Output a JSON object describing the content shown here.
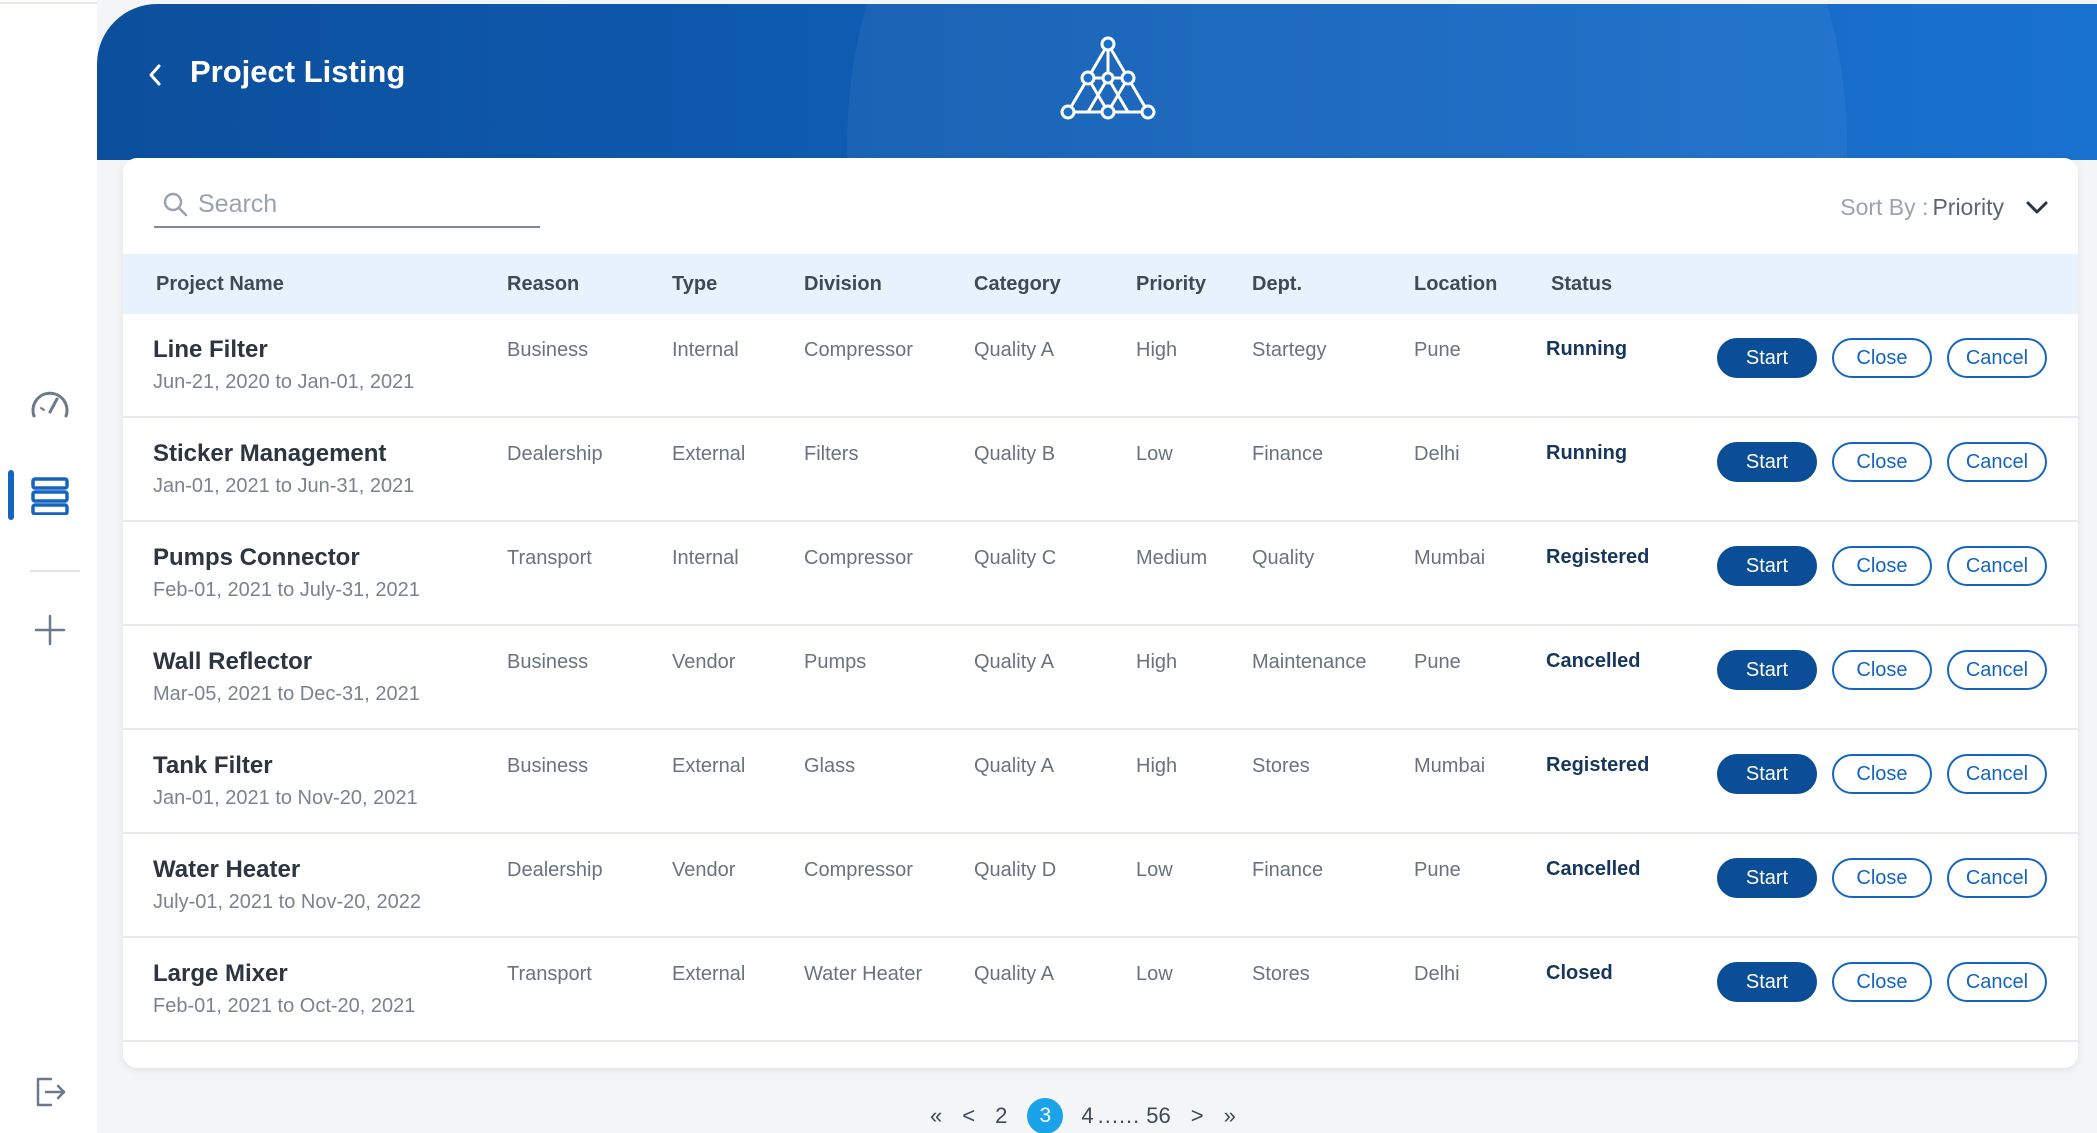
{
  "header": {
    "title": "Project Listing",
    "back_icon": "chevron-left-icon",
    "logo_icon": "network-triangle-logo"
  },
  "sidebar": {
    "items": [
      {
        "icon": "speedometer-icon",
        "active": false
      },
      {
        "icon": "database-list-icon",
        "active": true
      },
      {
        "icon": "plus-icon",
        "active": false
      },
      {
        "icon": "logout-icon",
        "active": false
      }
    ]
  },
  "search": {
    "placeholder": "Search",
    "value": ""
  },
  "sort": {
    "label": "Sort By :",
    "value": "Priority"
  },
  "table": {
    "columns": [
      "Project Name",
      "Reason",
      "Type",
      "Division",
      "Category",
      "Priority",
      "Dept.",
      "Location",
      "Status"
    ],
    "rows": [
      {
        "name": "Line Filter",
        "dates": "Jun-21, 2020 to Jan-01, 2021",
        "reason": "Business",
        "type": "Internal",
        "division": "Compressor",
        "category": "Quality A",
        "priority": "High",
        "dept": "Startegy",
        "location": "Pune",
        "status": "Running"
      },
      {
        "name": "Sticker Management",
        "dates": "Jan-01, 2021 to Jun-31, 2021",
        "reason": "Dealership",
        "type": "External",
        "division": "Filters",
        "category": "Quality B",
        "priority": "Low",
        "dept": "Finance",
        "location": "Delhi",
        "status": "Running"
      },
      {
        "name": "Pumps Connector",
        "dates": "Feb-01, 2021 to July-31, 2021",
        "reason": "Transport",
        "type": "Internal",
        "division": "Compressor",
        "category": "Quality C",
        "priority": "Medium",
        "dept": "Quality",
        "location": "Mumbai",
        "status": "Registered"
      },
      {
        "name": "Wall Reflector",
        "dates": "Mar-05, 2021 to Dec-31, 2021",
        "reason": "Business",
        "type": "Vendor",
        "division": "Pumps",
        "category": "Quality A",
        "priority": "High",
        "dept": "Maintenance",
        "location": "Pune",
        "status": "Cancelled"
      },
      {
        "name": "Tank Filter",
        "dates": "Jan-01, 2021 to Nov-20, 2021",
        "reason": "Business",
        "type": "External",
        "division": "Glass",
        "category": "Quality A",
        "priority": "High",
        "dept": "Stores",
        "location": "Mumbai",
        "status": "Registered"
      },
      {
        "name": "Water Heater",
        "dates": "July-01, 2021 to Nov-20, 2022",
        "reason": "Dealership",
        "type": "Vendor",
        "division": "Compressor",
        "category": "Quality D",
        "priority": "Low",
        "dept": "Finance",
        "location": "Pune",
        "status": "Cancelled"
      },
      {
        "name": "Large Mixer",
        "dates": "Feb-01, 2021 to Oct-20, 2021",
        "reason": "Transport",
        "type": "External",
        "division": "Water Heater",
        "category": "Quality A",
        "priority": "Low",
        "dept": "Stores",
        "location": "Delhi",
        "status": "Closed"
      }
    ],
    "actions": {
      "start": "Start",
      "close": "Close",
      "cancel": "Cancel"
    }
  },
  "pagination": {
    "first": "«",
    "prev": "<",
    "pages_before": [
      "2"
    ],
    "current": "3",
    "pages_after": [
      "4"
    ],
    "ellipsis": "......",
    "last_page": "56",
    "next": ">",
    "last": "»"
  },
  "colors": {
    "header_blue": "#0c4f9c",
    "primary_button": "#0b4d96",
    "accent": "#1565c0",
    "current_page": "#1aa3e8",
    "table_header_bg": "#e8f2fc"
  }
}
